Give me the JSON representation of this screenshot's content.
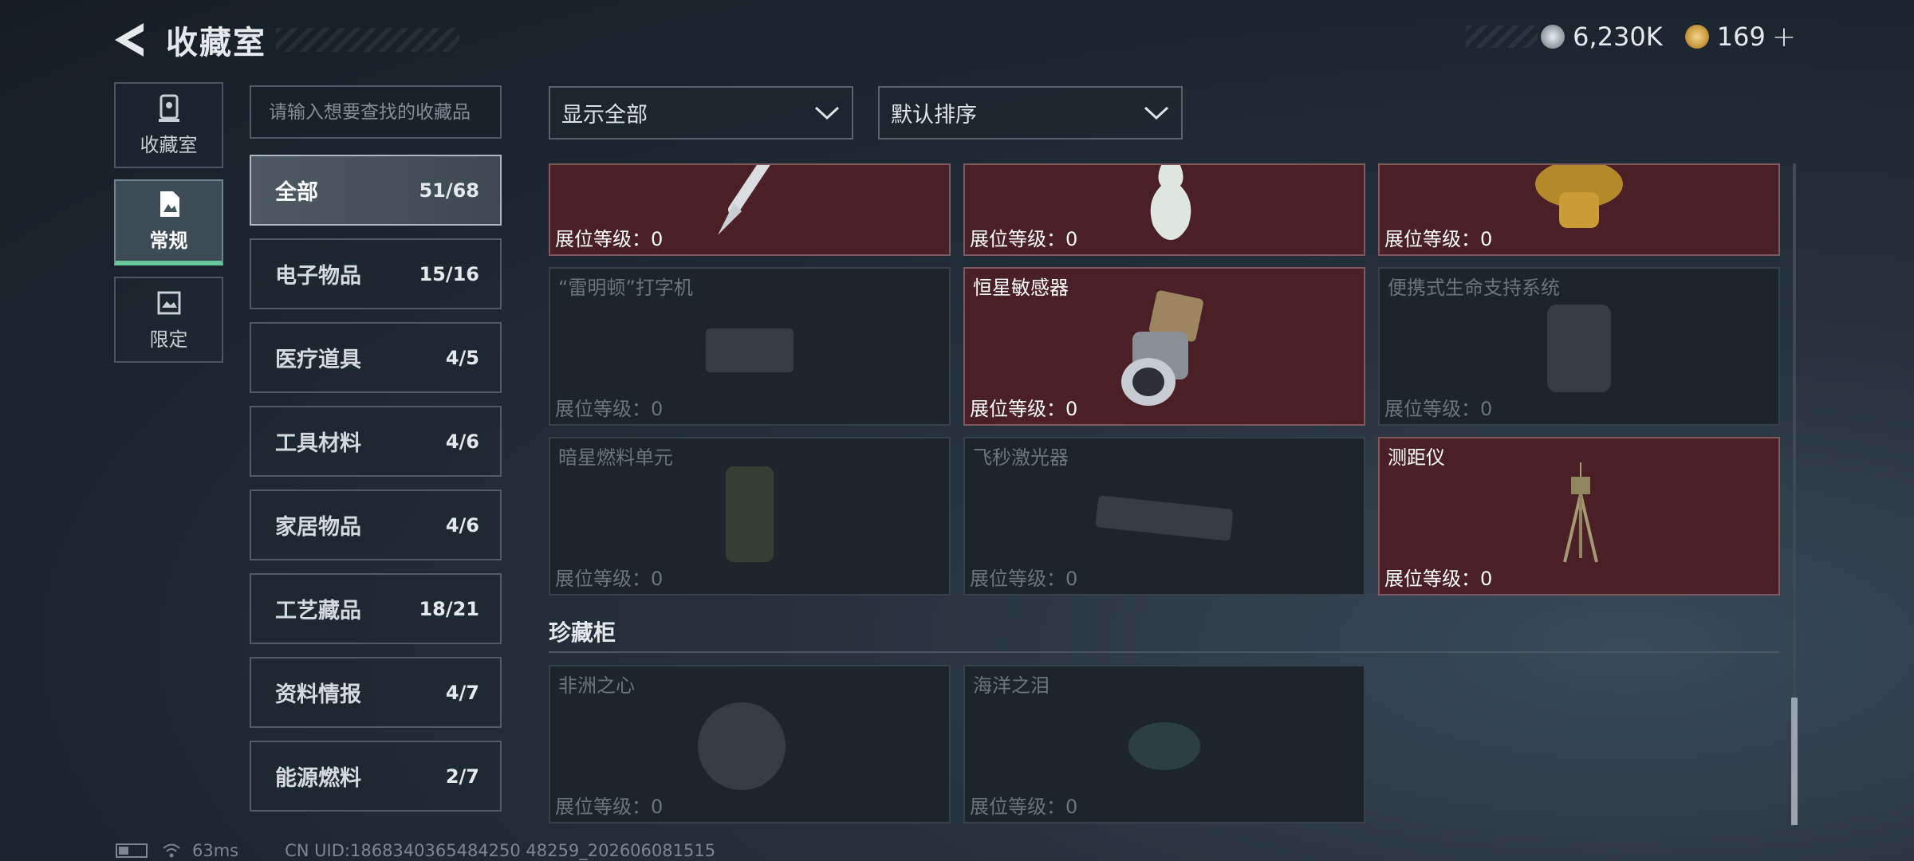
{
  "header": {
    "title": "收藏室"
  },
  "currency": {
    "coins": "6,230K",
    "tokens": "169",
    "plus": "+",
    "coin_color": "#c9cdd1",
    "token_color": "#d9b15a"
  },
  "leftnav": {
    "items": [
      {
        "label": "收藏室",
        "icon": "trophy-cabinet-icon"
      },
      {
        "label": "常规",
        "icon": "document-icon",
        "active": true
      },
      {
        "label": "限定",
        "icon": "frame-icon"
      }
    ]
  },
  "search": {
    "placeholder": "请输入想要查找的收藏品"
  },
  "categories": [
    {
      "label": "全部",
      "count": "51/68",
      "active": true
    },
    {
      "label": "电子物品",
      "count": "15/16"
    },
    {
      "label": "医疗道具",
      "count": "4/5"
    },
    {
      "label": "工具材料",
      "count": "4/6"
    },
    {
      "label": "家居物品",
      "count": "4/6"
    },
    {
      "label": "工艺藏品",
      "count": "18/21"
    },
    {
      "label": "资料情报",
      "count": "4/7"
    },
    {
      "label": "能源燃料",
      "count": "2/7"
    }
  ],
  "filters": {
    "display": "显示全部",
    "sort": "默认排序"
  },
  "level_label": "展位等级：0",
  "items": [
    {
      "name": "",
      "state": "owned",
      "image": "fountain-pen"
    },
    {
      "name": "",
      "state": "owned",
      "image": "porcelain-vase"
    },
    {
      "name": "",
      "state": "owned",
      "image": "golden-statue"
    },
    {
      "name": "“雷明顿”打字机",
      "state": "locked",
      "image": "typewriter"
    },
    {
      "name": "恒星敏感器",
      "state": "owned",
      "image": "star-sensor"
    },
    {
      "name": "便携式生命支持系统",
      "state": "locked",
      "image": "life-support"
    },
    {
      "name": "暗星燃料单元",
      "state": "locked",
      "image": "fuel-cell"
    },
    {
      "name": "飞秒激光器",
      "state": "locked",
      "image": "laser"
    },
    {
      "name": "测距仪",
      "state": "owned",
      "image": "rangefinder-tripod"
    }
  ],
  "section": {
    "title": "珍藏柜"
  },
  "treasures": [
    {
      "name": "非洲之心",
      "state": "locked",
      "image": "gem"
    },
    {
      "name": "海洋之泪",
      "state": "locked",
      "image": "gem-blue"
    }
  ],
  "footer": {
    "ping": "63ms",
    "uid": "CN UID:1868340365484250 48259_202606081515"
  },
  "colors": {
    "owned_bg": "#4a1f25",
    "locked_bg": "#1d252b",
    "accent": "#67c79b"
  }
}
